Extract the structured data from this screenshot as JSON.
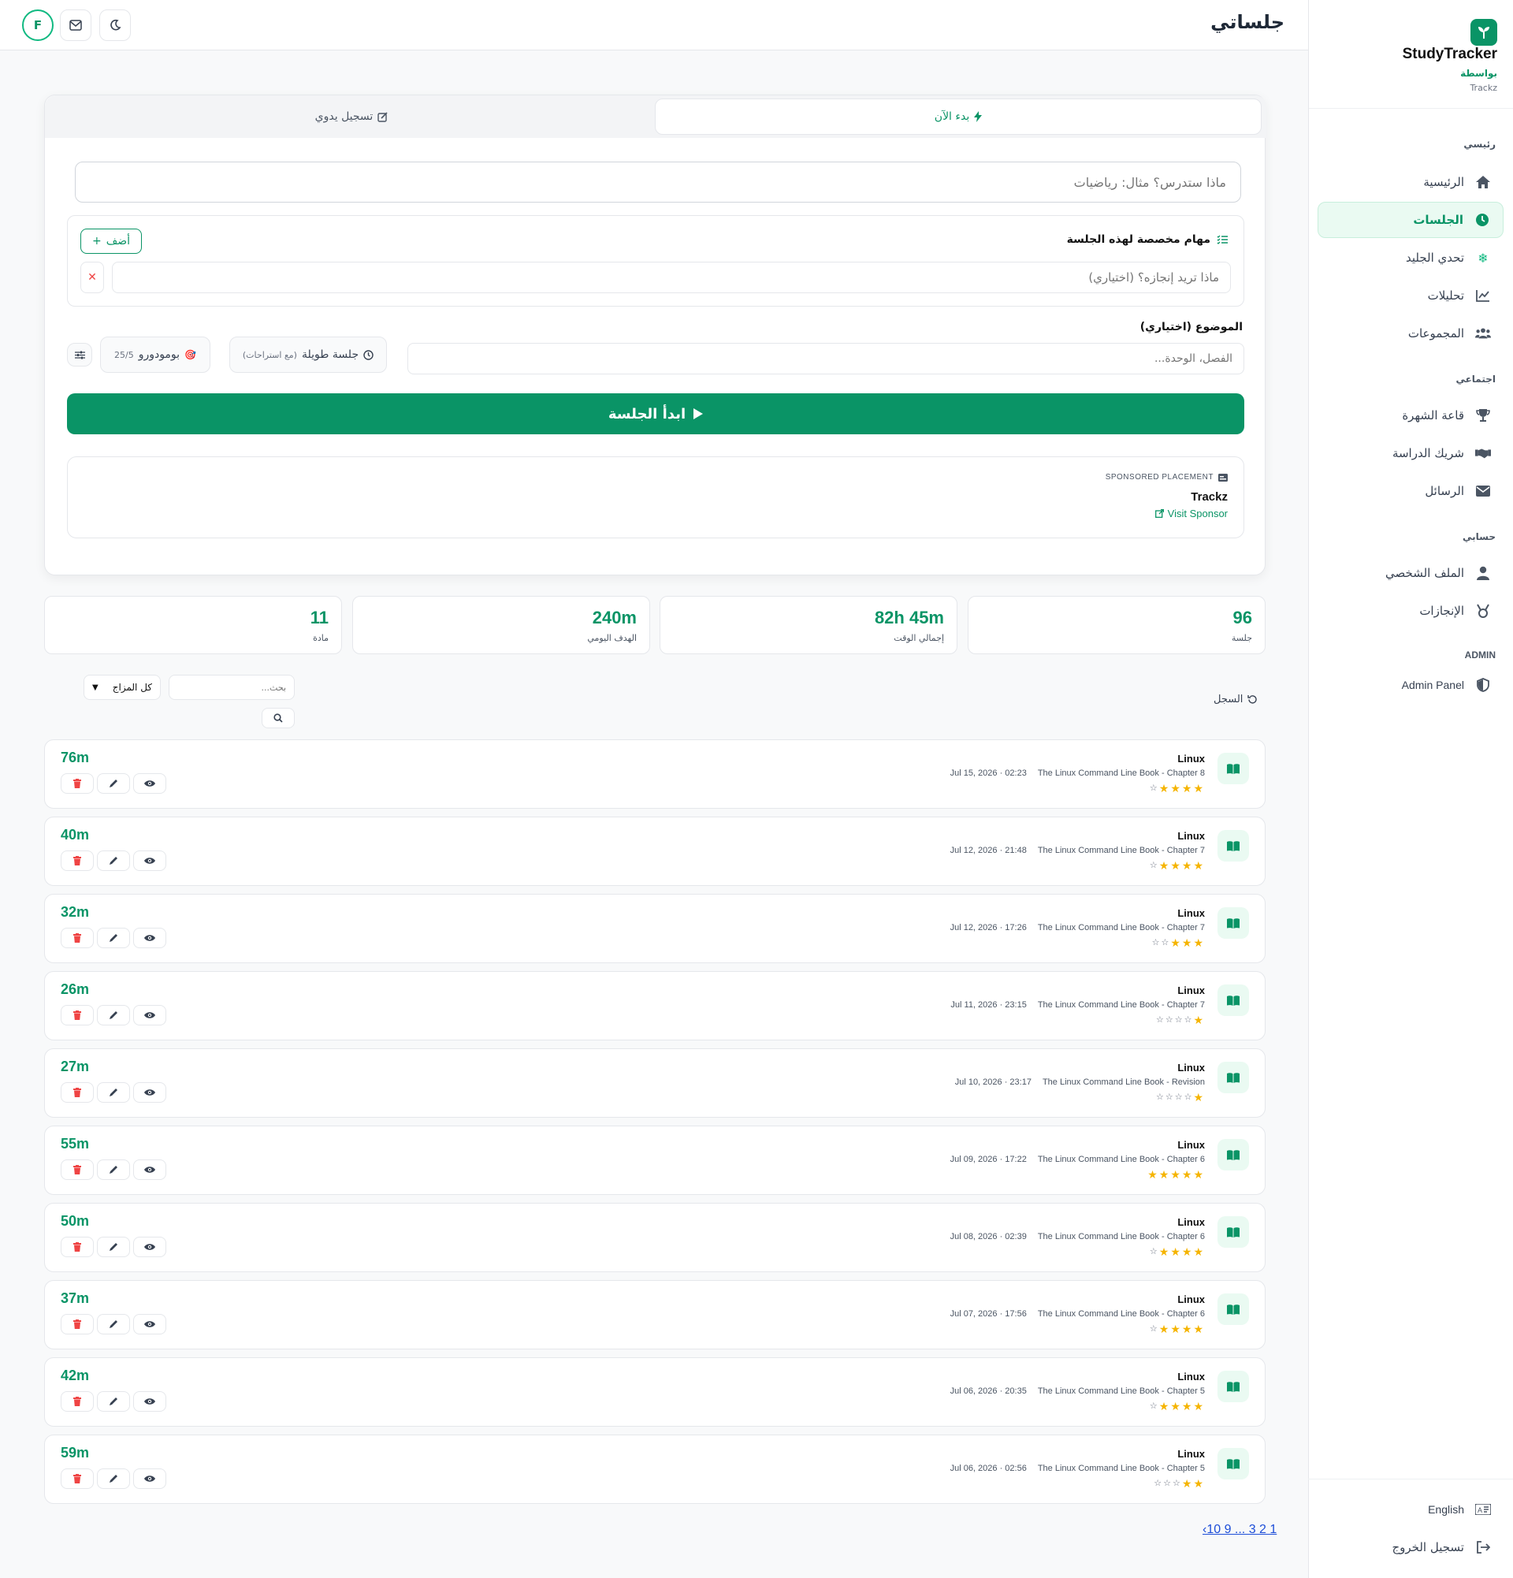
{
  "brand": {
    "title": "StudyTracker",
    "by": "بواسطة",
    "org": "Trackz"
  },
  "header": {
    "title": "جلساتي",
    "avatar": "F"
  },
  "sidebar": {
    "sections": [
      {
        "label": "رئيسي",
        "items": [
          {
            "label": "الرئيسية",
            "icon": "home-icon"
          },
          {
            "label": "الجلسات",
            "icon": "clock-icon",
            "active": true
          },
          {
            "label": "تحدي الجليد",
            "icon": "snowflake-icon"
          },
          {
            "label": "تحليلات",
            "icon": "chart-icon"
          },
          {
            "label": "المجموعات",
            "icon": "users-icon"
          }
        ]
      },
      {
        "label": "اجتماعي",
        "items": [
          {
            "label": "قاعة الشهرة",
            "icon": "trophy-icon"
          },
          {
            "label": "شريك الدراسة",
            "icon": "handshake-icon"
          },
          {
            "label": "الرسائل",
            "icon": "envelope-icon"
          }
        ]
      },
      {
        "label": "حسابي",
        "items": [
          {
            "label": "الملف الشخصي",
            "icon": "user-icon"
          },
          {
            "label": "الإنجازات",
            "icon": "medal-icon"
          }
        ]
      },
      {
        "label": "ADMIN",
        "items": [
          {
            "label": "Admin Panel",
            "icon": "shield-icon"
          }
        ]
      }
    ],
    "language": "English",
    "logout": "تسجيل الخروج"
  },
  "session": {
    "tab_now": "بدء الآن",
    "tab_manual": "تسجيل يدوي",
    "subject_placeholder": "ماذا ستدرس؟ مثال: رياضيات",
    "tasks_title": "مهام مخصصة لهذه الجلسة",
    "add_label": "أضف",
    "task_placeholder": "ماذا تريد إنجازه؟ (اختياري)",
    "topic_label": "الموضوع (اختياري)",
    "topic_placeholder": "الفصل، الوحدة...",
    "long_session": "جلسة طويلة",
    "long_session_note": "(مع استراحات)",
    "pomodoro": "بومودورو",
    "pomodoro_ratio": "25/5",
    "start_label": "ابدأ الجلسة"
  },
  "sponsor": {
    "label": "SPONSORED PLACEMENT",
    "name": "Trackz",
    "link": "Visit Sponsor"
  },
  "stats": [
    {
      "value": "96",
      "label": "جلسة"
    },
    {
      "value": "82h 45m",
      "label": "إجمالي الوقت"
    },
    {
      "value": "240m",
      "label": "الهدف اليومي"
    },
    {
      "value": "11",
      "label": "مادة"
    }
  ],
  "history": {
    "label": "السجل",
    "search_placeholder": "بحث...",
    "mood_filter": "كل المزاج",
    "rows": [
      {
        "subject": "Linux",
        "topic": "The Linux Command Line Book - Chapter 8",
        "date": "Jul 15, 2026 · 02:23",
        "rating": 4,
        "duration": "76m"
      },
      {
        "subject": "Linux",
        "topic": "The Linux Command Line Book - Chapter 7",
        "date": "Jul 12, 2026 · 21:48",
        "rating": 4,
        "duration": "40m"
      },
      {
        "subject": "Linux",
        "topic": "The Linux Command Line Book - Chapter 7",
        "date": "Jul 12, 2026 · 17:26",
        "rating": 3,
        "duration": "32m"
      },
      {
        "subject": "Linux",
        "topic": "The Linux Command Line Book - Chapter 7",
        "date": "Jul 11, 2026 · 23:15",
        "rating": 1,
        "duration": "26m"
      },
      {
        "subject": "Linux",
        "topic": "The Linux Command Line Book - Revision",
        "date": "Jul 10, 2026 · 23:17",
        "rating": 1,
        "duration": "27m"
      },
      {
        "subject": "Linux",
        "topic": "The Linux Command Line Book - Chapter 6",
        "date": "Jul 09, 2026 · 17:22",
        "rating": 5,
        "duration": "55m"
      },
      {
        "subject": "Linux",
        "topic": "The Linux Command Line Book - Chapter 6",
        "date": "Jul 08, 2026 · 02:39",
        "rating": 4,
        "duration": "50m"
      },
      {
        "subject": "Linux",
        "topic": "The Linux Command Line Book - Chapter 6",
        "date": "Jul 07, 2026 · 17:56",
        "rating": 4,
        "duration": "37m"
      },
      {
        "subject": "Linux",
        "topic": "The Linux Command Line Book - Chapter 5",
        "date": "Jul 06, 2026 · 20:35",
        "rating": 4,
        "duration": "42m"
      },
      {
        "subject": "Linux",
        "topic": "The Linux Command Line Book - Chapter 5",
        "date": "Jul 06, 2026 · 02:56",
        "rating": 2,
        "duration": "59m"
      }
    ],
    "pagination": "‹10 9 ... 3 2 1"
  },
  "colors": {
    "accent": "#0a9466",
    "star": "#f5b400",
    "danger": "#ef4444"
  }
}
